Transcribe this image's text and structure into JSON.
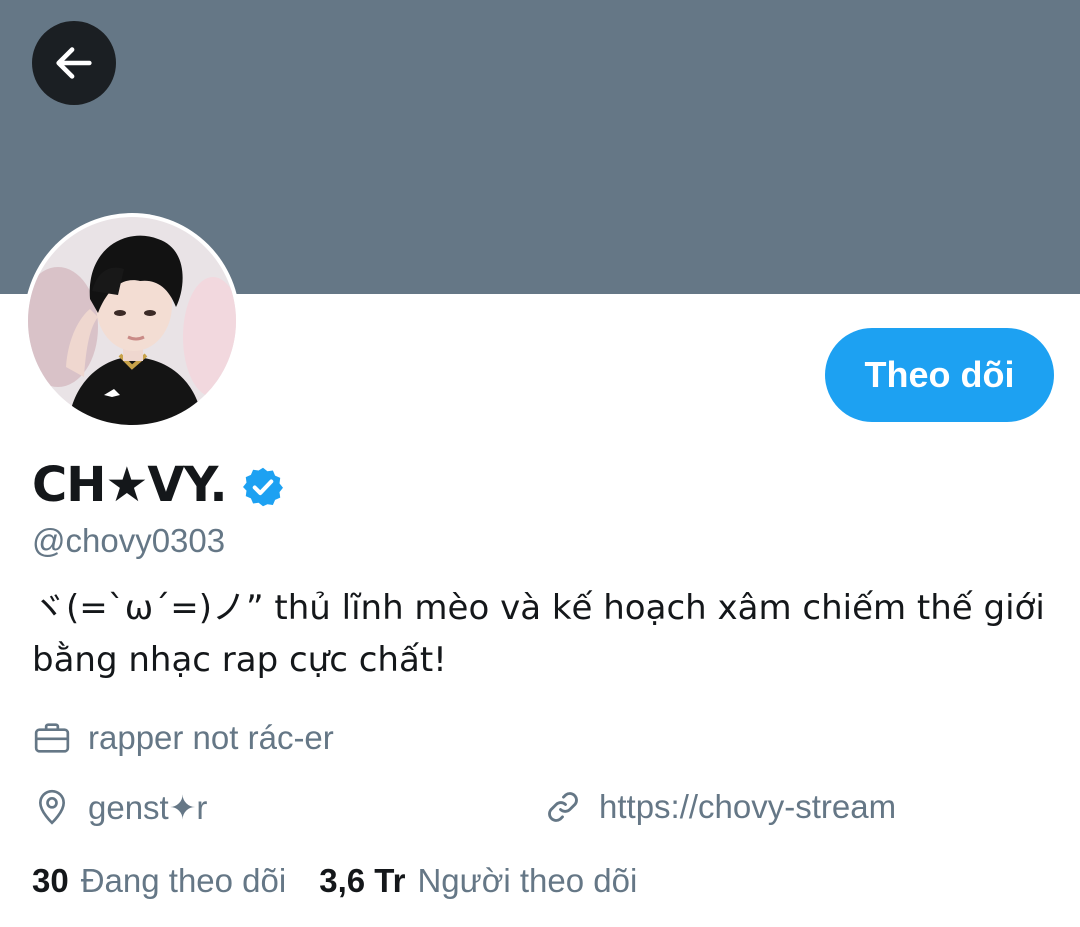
{
  "header": {
    "back_icon": "arrow-left-icon",
    "banner_color": "#657786"
  },
  "profile": {
    "avatar_alt": "profile-photo",
    "display_name": "CH★VY.",
    "verified_icon": "verified-badge-icon",
    "handle": "@chovy0303",
    "bio": "ヾ(=`ω´=)ノ” thủ lĩnh mèo và kế hoạch xâm chiếm thế giới bằng nhạc rap cực chất!",
    "occupation": "rapper not rác-er",
    "location": "genst✦r",
    "website": "https://chovy-stream"
  },
  "actions": {
    "follow_label": "Theo dõi",
    "accent_color": "#1da1f2"
  },
  "stats": {
    "following_count": "30",
    "following_label": "Đang theo dõi",
    "followers_count": "3,6 Tr",
    "followers_label": "Người theo dõi"
  }
}
